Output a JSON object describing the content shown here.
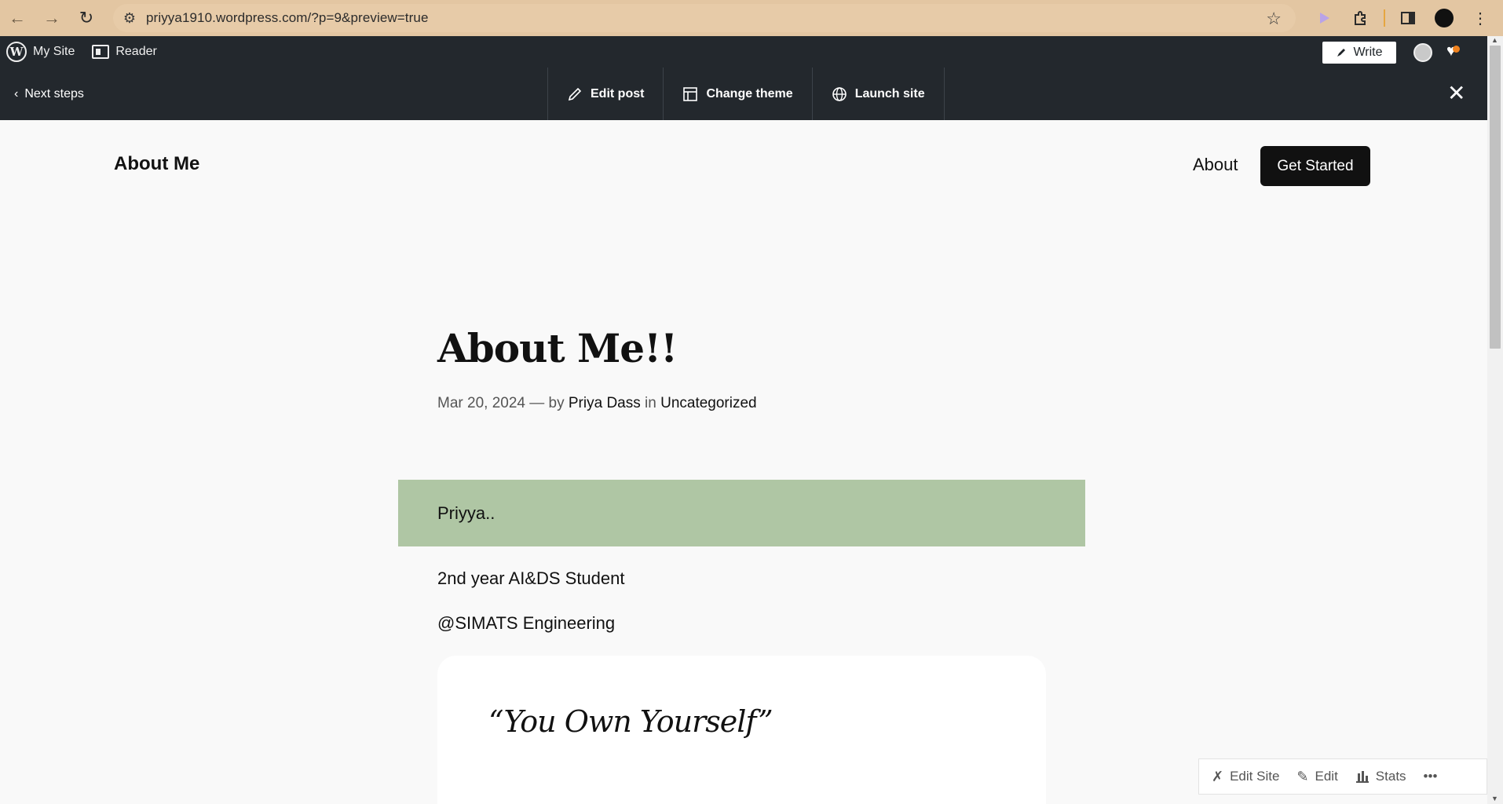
{
  "browser": {
    "url": "priyya1910.wordpress.com/?p=9&preview=true",
    "icons": [
      "back-icon",
      "forward-icon",
      "reload-icon",
      "site-info-icon",
      "star-icon",
      "extension-icon",
      "puzzle-icon",
      "side-panel-icon",
      "profile-icon",
      "menu-icon"
    ]
  },
  "adminbar": {
    "my_site": "My Site",
    "reader": "Reader",
    "write": "Write"
  },
  "preview_bar": {
    "next_steps": "Next steps",
    "edit_post": "Edit post",
    "change_theme": "Change theme",
    "launch_site": "Launch site"
  },
  "site": {
    "title": "About Me",
    "nav_about": "About",
    "get_started": "Get Started"
  },
  "post": {
    "title": "About Me!!",
    "date": "Mar 20, 2024",
    "dash_by": " — by ",
    "author": "Priya Dass",
    "in": " in ",
    "category": "Uncategorized",
    "highlight": "Priyya..",
    "line1": "2nd year AI&DS Student",
    "line2": "@SIMATS Engineering",
    "quote": "“You Own Yourself”"
  },
  "float_actions": {
    "edit_site": "Edit Site",
    "edit": "Edit",
    "stats": "Stats",
    "more": "•••"
  },
  "colors": {
    "adminbar_bg": "#23282d",
    "highlight_bg": "#afc6a4",
    "browser_bar": "#e3c6a2"
  }
}
